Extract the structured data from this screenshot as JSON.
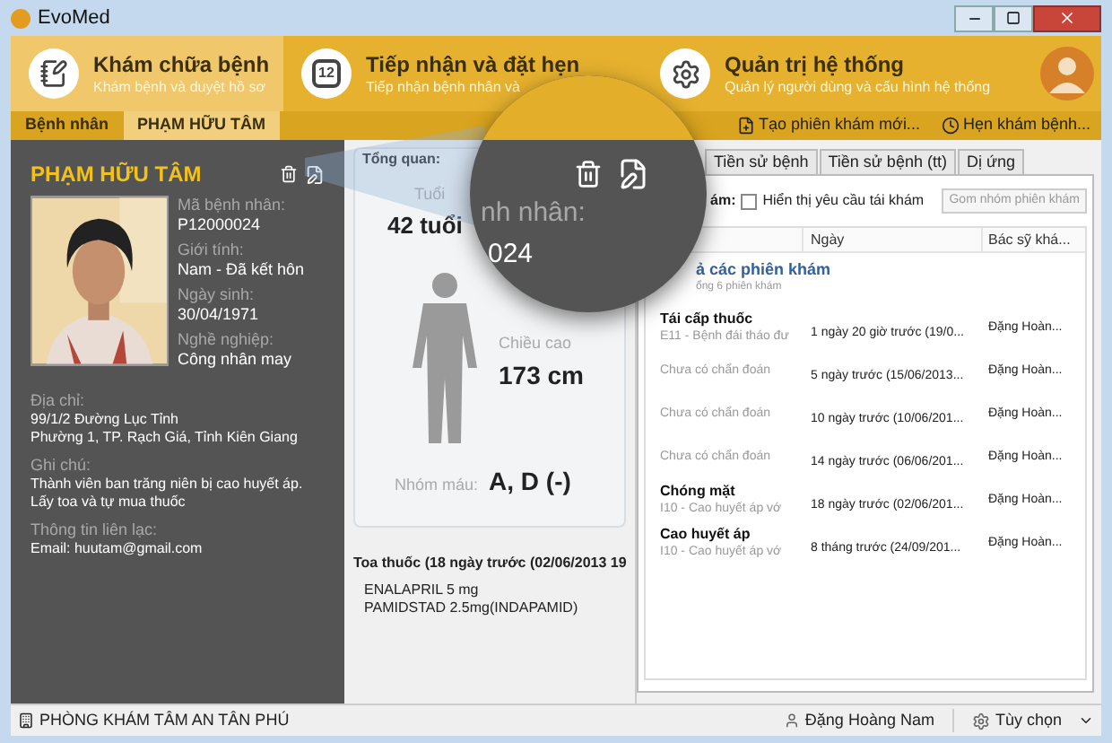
{
  "window": {
    "title": "EvoMed"
  },
  "modules": [
    {
      "kind": "notepad",
      "title": "Khám chữa bệnh",
      "subtitle": "Khám bệnh và duyệt hồ sơ",
      "selected": true
    },
    {
      "kind": "calendar",
      "badge": "12",
      "title": "Tiếp nhận và đặt hẹn",
      "subtitle": "Tiếp nhận bệnh nhân và",
      "selected": false
    },
    {
      "kind": "gear",
      "title": "Quản trị hệ thống",
      "subtitle": "Quản lý người dùng và cấu hình hệ thống",
      "selected": false
    }
  ],
  "breadcrumb": [
    {
      "label": "Bệnh nhân",
      "selected": false
    },
    {
      "label": "PHẠM HỮU TÂM",
      "selected": true
    }
  ],
  "actions": [
    {
      "kind": "new",
      "label": "Tạo phiên khám mới..."
    },
    {
      "kind": "appointment",
      "label": "Hẹn khám bệnh..."
    }
  ],
  "patient": {
    "name": "PHẠM HỮU TÂM",
    "fields": [
      {
        "label": "Mã bệnh nhân:",
        "value": "P12000024"
      },
      {
        "label": "Giới tính:",
        "value": "Nam - Đã kết hôn"
      },
      {
        "label": "Ngày sinh:",
        "value": "30/04/1971"
      },
      {
        "label": "Nghề nghiệp:",
        "value": "Công nhân may"
      }
    ],
    "details": [
      {
        "label": "Địa chỉ:",
        "lines": [
          "99/1/2 Đường Lục Tỉnh",
          "Phường 1, TP. Rạch Giá, Tỉnh Kiên Giang"
        ]
      },
      {
        "label": "Ghi chú:",
        "lines": [
          "Thành viên ban trăng niên bị cao huyết áp. Lấy toa và tự mua thuốc"
        ]
      },
      {
        "label": "Thông tin liên lạc:",
        "lines": [
          "Email: huutam@gmail.com"
        ]
      }
    ]
  },
  "overview": {
    "title": "Tổng quan:",
    "age_label": "Tuổi",
    "age": "42 tuổi",
    "height_label": "Chiều cao",
    "height": "173 cm",
    "blood_label": "Nhóm máu:",
    "blood": "A, D (-)"
  },
  "prescription": {
    "title": "Toa thuốc (18 ngày trước (02/06/2013 19",
    "items": [
      "ENALAPRIL 5 mg",
      "PAMIDSTAD 2.5mg(INDAPAMID)"
    ]
  },
  "magnifier": {
    "label_fragment": "nh nhân:",
    "value_fragment": "024"
  },
  "history": {
    "tabs": [
      {
        "label": "Tiền sử bệnh",
        "selected": false
      },
      {
        "label": "Tiền sử bệnh (tt)",
        "selected": false
      },
      {
        "label": "Dị ứng",
        "selected": false
      }
    ],
    "filter_label": "ám:",
    "checkbox": {
      "label": "Hiển thị yêu cầu tái khám",
      "checked": false
    },
    "group_button": {
      "label": "Gom nhóm phiên khám",
      "disabled": true
    },
    "columns": [
      "Ngày",
      "Bác sỹ khá..."
    ],
    "group": {
      "title": "ả các phiên khám",
      "subtitle": "ổng 6 phiên khám"
    },
    "rows": [
      {
        "title": "Tái cấp thuốc",
        "diagnosis": "E11 - Bệnh đái tháo đư",
        "date": "1 ngày 20 giờ trước (19/0...",
        "doctor": "Đặng Hoàn..."
      },
      {
        "diagnosis": "Chưa có chẩn đoán",
        "date": "5 ngày trước (15/06/2013...",
        "doctor": "Đặng Hoàn..."
      },
      {
        "diagnosis": "Chưa có chẩn đoán",
        "date": "10 ngày trước (10/06/201...",
        "doctor": "Đặng Hoàn..."
      },
      {
        "diagnosis": "Chưa có chẩn đoán",
        "date": "14 ngày trước (06/06/201...",
        "doctor": "Đặng Hoàn..."
      },
      {
        "title": "Chóng mặt",
        "diagnosis": "I10 - Cao huyết áp vớ",
        "date": "18 ngày trước (02/06/201...",
        "doctor": "Đặng Hoàn..."
      },
      {
        "title": "Cao huyết áp",
        "diagnosis": "I10 - Cao huyết áp vớ",
        "date": "8 tháng trước (24/09/201...",
        "doctor": "Đặng Hoàn..."
      }
    ]
  },
  "status_bar": {
    "clinic": "PHÒNG KHÁM TÂM AN TÂN PHÚ",
    "user": "Đặng Hoàng Nam",
    "options": "Tùy chọn"
  }
}
